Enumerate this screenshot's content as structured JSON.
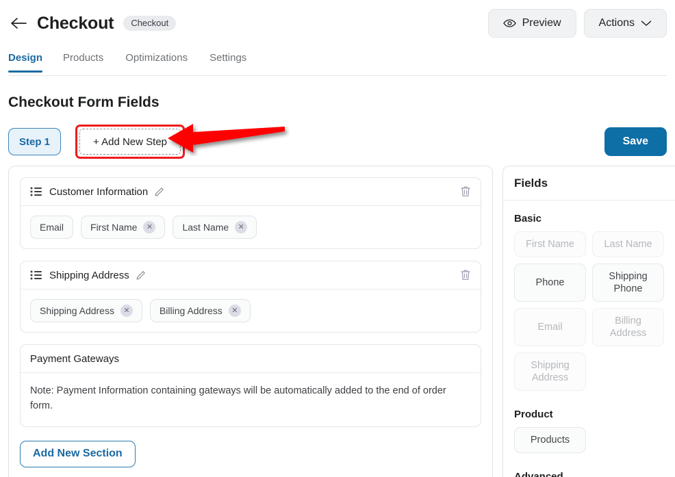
{
  "header": {
    "back_icon": "arrow-left-icon",
    "title": "Checkout",
    "badge": "Checkout",
    "preview_label": "Preview",
    "preview_icon": "eye-icon",
    "actions_label": "Actions",
    "actions_icon": "chevron-down-icon"
  },
  "tabs": [
    {
      "label": "Design",
      "active": true
    },
    {
      "label": "Products",
      "active": false
    },
    {
      "label": "Optimizations",
      "active": false
    },
    {
      "label": "Settings",
      "active": false
    }
  ],
  "page": {
    "section_title": "Checkout Form Fields",
    "step_label": "Step 1",
    "add_step_label": "+ Add New Step",
    "save_label": "Save",
    "add_section_label": "Add New Section"
  },
  "annotation": {
    "arrow_color": "#FF0000",
    "highlight_color": "#EF1B1B",
    "points_to": "add-new-step-button"
  },
  "form_sections": [
    {
      "title": "Customer Information",
      "has_edit": true,
      "has_delete": true,
      "chips": [
        {
          "label": "Email",
          "removable": false
        },
        {
          "label": "First Name",
          "removable": true
        },
        {
          "label": "Last Name",
          "removable": true
        }
      ]
    },
    {
      "title": "Shipping Address",
      "has_edit": true,
      "has_delete": true,
      "chips": [
        {
          "label": "Shipping Address",
          "removable": true
        },
        {
          "label": "Billing Address",
          "removable": true
        }
      ]
    },
    {
      "title": "Payment Gateways",
      "has_edit": false,
      "has_delete": false,
      "note": "Note: Payment Information containing gateways will be automatically added to the end of order form."
    }
  ],
  "fields_panel": {
    "title": "Fields",
    "groups": [
      {
        "label": "Basic",
        "items": [
          {
            "label": "First Name",
            "disabled": true
          },
          {
            "label": "Last Name",
            "disabled": true
          },
          {
            "label": "Phone",
            "disabled": false
          },
          {
            "label": "Shipping Phone",
            "disabled": false
          },
          {
            "label": "Email",
            "disabled": true
          },
          {
            "label": "Billing Address",
            "disabled": true
          },
          {
            "label": "Shipping Address",
            "disabled": true
          }
        ]
      },
      {
        "label": "Product",
        "items": [
          {
            "label": "Products",
            "disabled": false
          }
        ]
      },
      {
        "label": "Advanced",
        "items": []
      }
    ]
  },
  "colors": {
    "accent_blue": "#1a6aa3",
    "save_blue": "#0e6ea6",
    "step_fill": "#e7f2fa",
    "annotation_red": "#FF0000"
  }
}
